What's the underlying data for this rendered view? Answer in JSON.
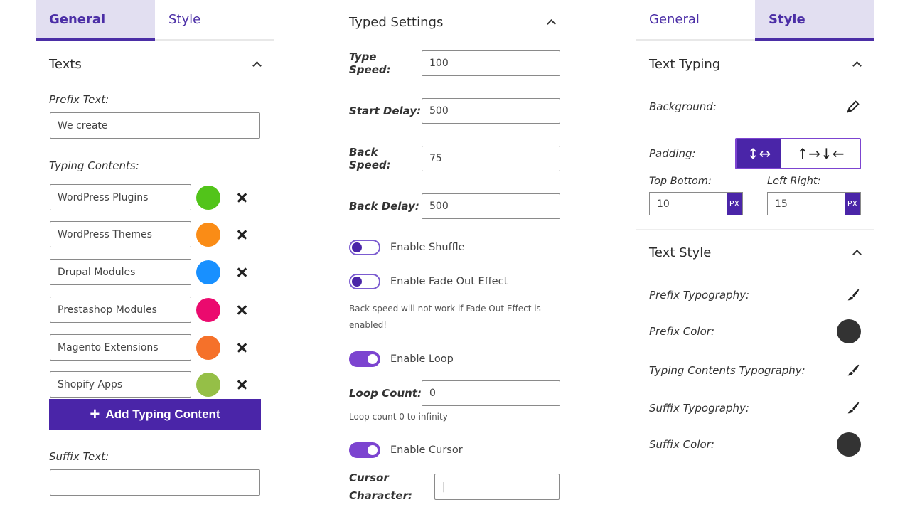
{
  "left_panel": {
    "tabs": [
      {
        "label": "General",
        "active": true
      },
      {
        "label": "Style",
        "active": false
      }
    ],
    "section_title": "Texts",
    "prefix_label": "Prefix Text:",
    "prefix_value": "We create",
    "typing_label": "Typing Contents:",
    "typing_items": [
      {
        "text": "WordPress Plugins",
        "color": "#52c41a"
      },
      {
        "text": "WordPress Themes",
        "color": "#fa8c16"
      },
      {
        "text": "Drupal Modules",
        "color": "#1890ff"
      },
      {
        "text": "Prestashop Modules",
        "color": "#eb0a6e"
      },
      {
        "text": "Magento Extensions",
        "color": "#f5712a"
      },
      {
        "text": "Shopify Apps",
        "color": "#95bf47"
      }
    ],
    "add_button_label": "Add Typing Content",
    "suffix_label": "Suffix Text:",
    "suffix_value": ""
  },
  "middle_panel": {
    "section_title": "Typed Settings",
    "type_speed_label": "Type Speed:",
    "type_speed_value": "100",
    "start_delay_label": "Start Delay:",
    "start_delay_value": "500",
    "back_speed_label": "Back Speed:",
    "back_speed_value": "75",
    "back_delay_label": "Back Delay:",
    "back_delay_value": "500",
    "shuffle_label": "Enable Shuffle",
    "shuffle_on": false,
    "fade_label": "Enable Fade Out Effect",
    "fade_on": false,
    "fade_help": "Back speed will not work if Fade Out Effect is enabled!",
    "loop_label": "Enable Loop",
    "loop_on": true,
    "loop_count_label": "Loop Count:",
    "loop_count_value": "0",
    "loop_help": "Loop count 0 to infinity",
    "cursor_label": "Enable Cursor",
    "cursor_on": true,
    "cursor_char_label": "Cursor Character:",
    "cursor_char_value": "|"
  },
  "right_panel": {
    "tabs": [
      {
        "label": "General",
        "active": false
      },
      {
        "label": "Style",
        "active": true
      }
    ],
    "text_typing_title": "Text Typing",
    "background_label": "Background:",
    "padding_label": "Padding:",
    "padding_mode_linked": "↕↔",
    "padding_mode_individual": "↑→↓←",
    "top_bottom_label": "Top Bottom:",
    "top_bottom_value": "10",
    "left_right_label": "Left Right:",
    "left_right_value": "15",
    "unit": "PX",
    "text_style_title": "Text Style",
    "prefix_typography_label": "Prefix Typography:",
    "prefix_color_label": "Prefix Color:",
    "prefix_color": "#333333",
    "typing_typography_label": "Typing Contents Typography:",
    "suffix_typography_label": "Suffix Typography:",
    "suffix_color_label": "Suffix Color:",
    "suffix_color": "#333333"
  },
  "colors": {
    "accent": "#4a25a8",
    "tab_active_bg": "#e2dff1",
    "toggle_on": "#7c44d0"
  }
}
